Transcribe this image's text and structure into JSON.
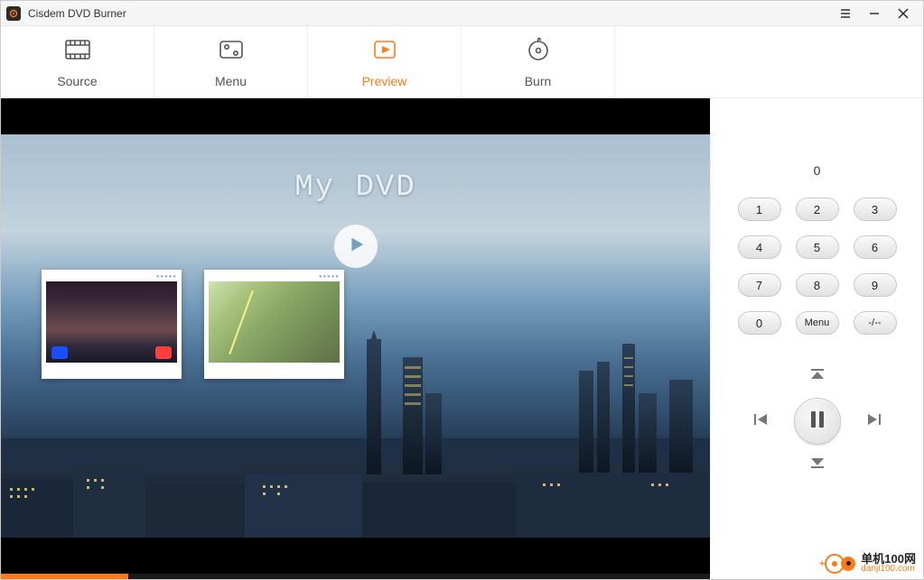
{
  "titlebar": {
    "title": "Cisdem DVD Burner"
  },
  "tabs": {
    "source": "Source",
    "menu": "Menu",
    "preview": "Preview",
    "burn": "Burn"
  },
  "preview": {
    "dvd_title": "My DVD"
  },
  "remote": {
    "display": "0",
    "keys": [
      "1",
      "2",
      "3",
      "4",
      "5",
      "6",
      "7",
      "8",
      "9",
      "0",
      "Menu",
      "-/--"
    ]
  },
  "watermark": {
    "cn": "单机100网",
    "url": "danji100.com"
  }
}
